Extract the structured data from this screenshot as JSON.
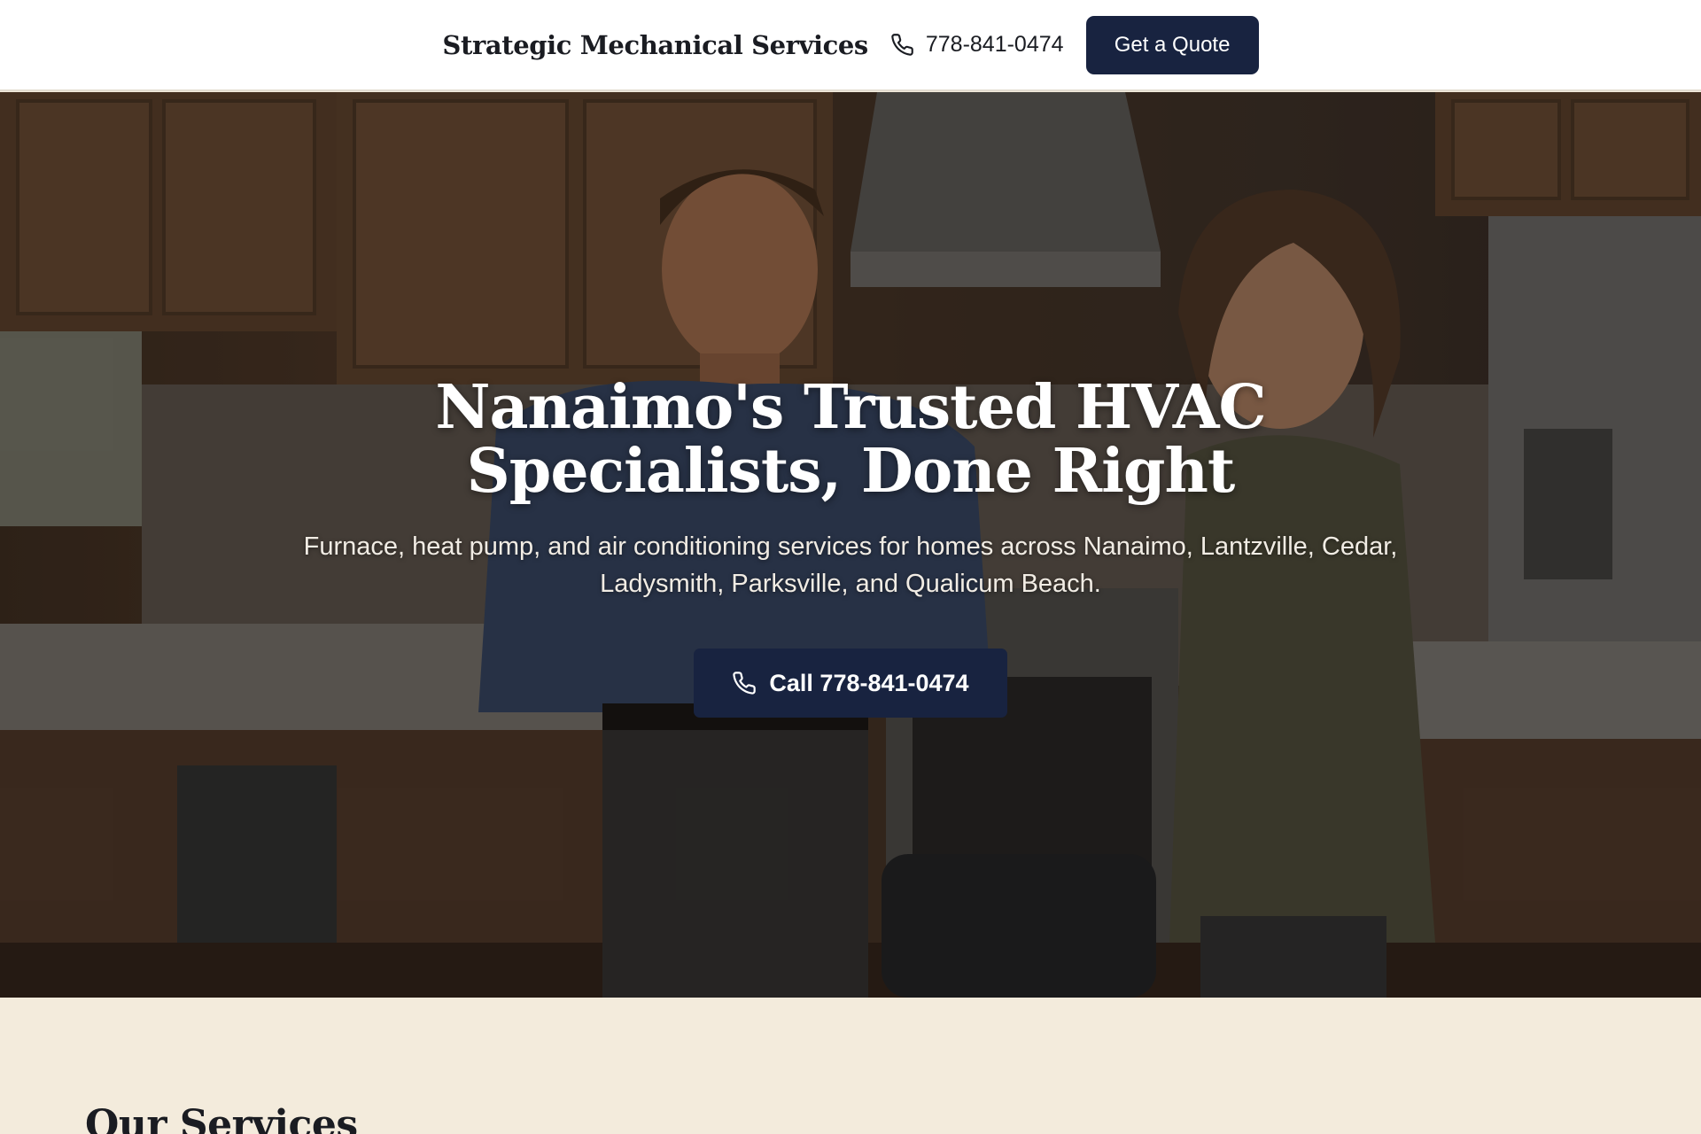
{
  "header": {
    "brand": "Strategic Mechanical Services",
    "phone": "778-841-0474",
    "phone_icon": "phone-icon",
    "cta_label": "Get a Quote"
  },
  "hero": {
    "title": "Nanaimo's Trusted HVAC Specialists, Done Right",
    "subtitle": "Furnace, heat pump, and air conditioning services for homes across Nanaimo, Lantzville, Cedar, Ladysmith, Parksville, and Qualicum Beach.",
    "call_label": "Call 778-841-0474",
    "call_icon": "phone-icon",
    "image_subject": "HVAC technician talking with homeowner in kitchen"
  },
  "services": {
    "title": "Our Services"
  },
  "colors": {
    "primary": "#182340",
    "section_bg": "#f3ebdc",
    "header_bg": "#ffffff"
  }
}
